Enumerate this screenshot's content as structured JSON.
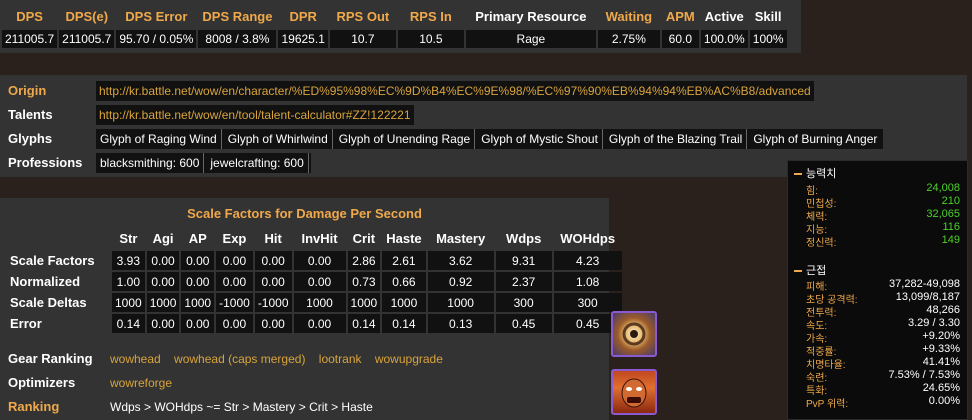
{
  "stats": {
    "headers": [
      "DPS",
      "DPS(e)",
      "DPS Error",
      "DPS Range",
      "DPR",
      "RPS Out",
      "RPS In",
      "Primary Resource",
      "Waiting",
      "APM",
      "Active",
      "Skill"
    ],
    "values": [
      "211005.7",
      "211005.7",
      "95.70 / 0.05%",
      "8008 / 3.8%",
      "19625.1",
      "10.7",
      "10.5",
      "Rage",
      "2.75%",
      "60.0",
      "100.0%",
      "100%"
    ]
  },
  "profile": {
    "origin_label": "Origin",
    "origin_url": "http://kr.battle.net/wow/en/character/%ED%95%98%EC%9D%B4%EC%9E%98/%EC%97%90%EB%94%94%EB%AC%B8/advanced",
    "talents_label": "Talents",
    "talents_url": "http://kr.battle.net/wow/en/tool/talent-calculator#ZZ!122221",
    "glyphs_label": "Glyphs",
    "glyphs": [
      "Glyph of Raging Wind",
      "Glyph of Whirlwind",
      "Glyph of Unending Rage",
      "Glyph of Mystic Shout",
      "Glyph of the Blazing Trail",
      "Glyph of Burning Anger"
    ],
    "professions_label": "Professions",
    "professions": [
      "blacksmithing: 600",
      "jewelcrafting: 600"
    ]
  },
  "scale": {
    "title": "Scale Factors for  Damage Per Second",
    "columns": [
      "Str",
      "Agi",
      "AP",
      "Exp",
      "Hit",
      "InvHit",
      "Crit",
      "Haste",
      "Mastery",
      "Wdps",
      "WOHdps"
    ],
    "rows": [
      {
        "label": "Scale Factors",
        "values": [
          "3.93",
          "0.00",
          "0.00",
          "0.00",
          "0.00",
          "0.00",
          "2.86",
          "2.61",
          "3.62",
          "9.31",
          "4.23"
        ]
      },
      {
        "label": "Normalized",
        "values": [
          "1.00",
          "0.00",
          "0.00",
          "0.00",
          "0.00",
          "0.00",
          "0.73",
          "0.66",
          "0.92",
          "2.37",
          "1.08"
        ]
      },
      {
        "label": "Scale Deltas",
        "values": [
          "1000",
          "1000",
          "1000",
          "-1000",
          "-1000",
          "1000",
          "1000",
          "1000",
          "1000",
          "300",
          "300"
        ]
      },
      {
        "label": "Error",
        "values": [
          "0.14",
          "0.00",
          "0.00",
          "0.00",
          "0.00",
          "0.00",
          "0.14",
          "0.14",
          "0.13",
          "0.45",
          "0.45"
        ]
      }
    ],
    "gear_label": "Gear Ranking",
    "gear_links": [
      "wowhead",
      "wowhead (caps merged)",
      "lootrank",
      "wowupgrade"
    ],
    "optimizers_label": "Optimizers",
    "optimizers_links": [
      "wowreforge"
    ],
    "ranking_label": "Ranking",
    "ranking_value": "Wdps > WOHdps ~= Str > Mastery > Crit > Haste"
  },
  "icons": [
    "mystic-shout-icon",
    "berserker-icon"
  ],
  "tooltip": {
    "section1": "능력치",
    "stats1": [
      {
        "label": "힘:",
        "value": "24,008"
      },
      {
        "label": "민첩성:",
        "value": "210"
      },
      {
        "label": "체력:",
        "value": "32,065"
      },
      {
        "label": "지능:",
        "value": "116"
      },
      {
        "label": "정신력:",
        "value": "149"
      }
    ],
    "section2": "근접",
    "stats2": [
      {
        "label": "피해:",
        "value": "37,282-49,098"
      },
      {
        "label": "초당 공격력:",
        "value": "13,099/8,187"
      },
      {
        "label": "전투력:",
        "value": "48,266"
      },
      {
        "label": "속도:",
        "value": "3.29 / 3.30"
      },
      {
        "label": "가속:",
        "value": "+9.20%"
      },
      {
        "label": "적중률:",
        "value": "+9.33%"
      },
      {
        "label": "치명타율:",
        "value": "41.41%"
      },
      {
        "label": "숙련:",
        "value": "7.53% / 7.53%"
      },
      {
        "label": "특화:",
        "value": "24.65%"
      },
      {
        "label": "PvP 위력:",
        "value": "0.00%"
      }
    ]
  }
}
